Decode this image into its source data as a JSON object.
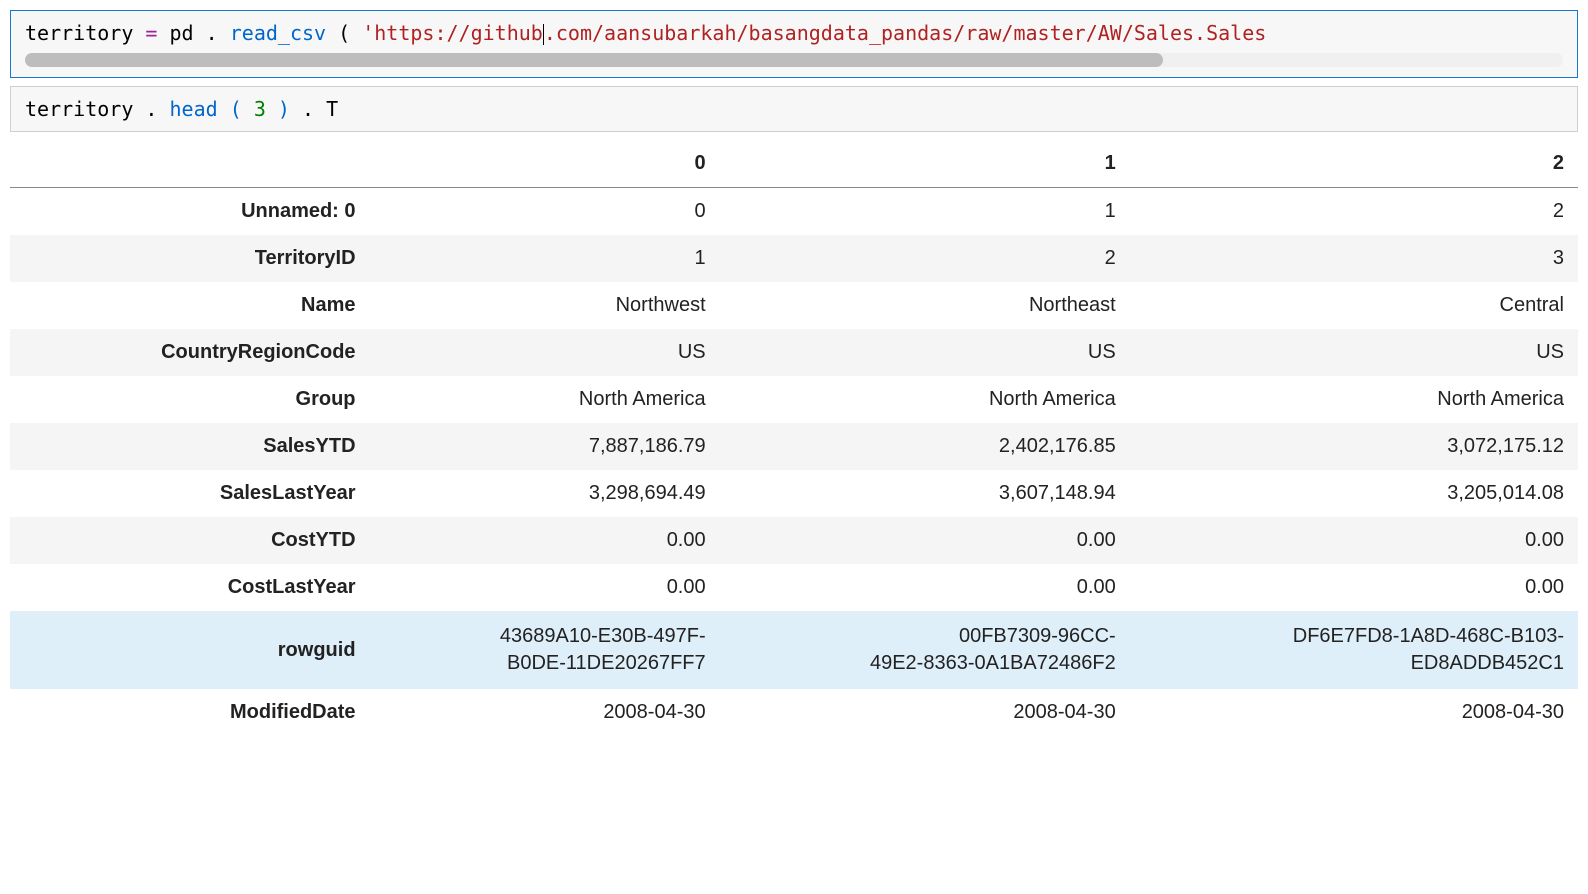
{
  "cells": {
    "code1": {
      "var": "territory",
      "op1": " = ",
      "obj": "pd",
      "dot": ".",
      "func": "read_csv",
      "paren_open": "(",
      "str_left": "'https://github",
      "str_right": ".com/aansubarkah/basangdata_pandas/raw/master/AW/Sales.Sales"
    },
    "code2": {
      "var": "territory",
      "dot": ".",
      "func": "head",
      "paren_open": "(",
      "num": "3",
      "paren_close": ")",
      "dot2": ".",
      "attr": "T"
    }
  },
  "table": {
    "columns": [
      "0",
      "1",
      "2"
    ],
    "rows": [
      {
        "label": "Unnamed: 0",
        "values": [
          "0",
          "1",
          "2"
        ],
        "stripe": false
      },
      {
        "label": "TerritoryID",
        "values": [
          "1",
          "2",
          "3"
        ],
        "stripe": true
      },
      {
        "label": "Name",
        "values": [
          "Northwest",
          "Northeast",
          "Central"
        ],
        "stripe": false
      },
      {
        "label": "CountryRegionCode",
        "values": [
          "US",
          "US",
          "US"
        ],
        "stripe": true
      },
      {
        "label": "Group",
        "values": [
          "North America",
          "North America",
          "North America"
        ],
        "stripe": false
      },
      {
        "label": "SalesYTD",
        "values": [
          "7,887,186.79",
          "2,402,176.85",
          "3,072,175.12"
        ],
        "stripe": true
      },
      {
        "label": "SalesLastYear",
        "values": [
          "3,298,694.49",
          "3,607,148.94",
          "3,205,014.08"
        ],
        "stripe": false
      },
      {
        "label": "CostYTD",
        "values": [
          "0.00",
          "0.00",
          "0.00"
        ],
        "stripe": true
      },
      {
        "label": "CostLastYear",
        "values": [
          "0.00",
          "0.00",
          "0.00"
        ],
        "stripe": false
      },
      {
        "label": "rowguid",
        "values": [
          "43689A10-E30B-497F-\nB0DE-11DE20267FF7",
          "00FB7309-96CC-\n49E2-8363-0A1BA72486F2",
          "DF6E7FD8-1A8D-468C-B103-\nED8ADDB452C1"
        ],
        "highlight": true
      },
      {
        "label": "ModifiedDate",
        "values": [
          "2008-04-30",
          "2008-04-30",
          "2008-04-30"
        ],
        "stripe": false
      }
    ]
  }
}
